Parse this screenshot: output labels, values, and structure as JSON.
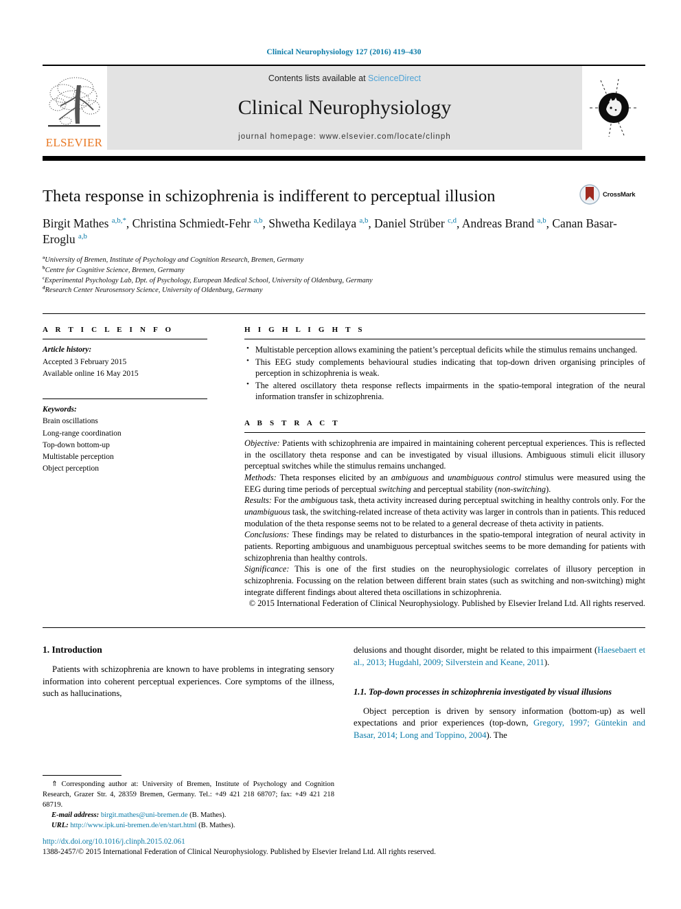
{
  "running_head": "Clinical Neurophysiology 127 (2016) 419–430",
  "masthead": {
    "contents_prefix": "Contents lists available at ",
    "sciencedirect": "ScienceDirect",
    "journal_title": "Clinical Neurophysiology",
    "homepage": "journal homepage: www.elsevier.com/locate/clinph",
    "publisher_wordmark": "ELSEVIER",
    "publisher_logo_name": "elsevier-tree-logo",
    "journal_cover_name": "journal-cover-thumbnail"
  },
  "colors": {
    "link": "#0b7ba8",
    "sciencedirect": "#4ea3d6",
    "elsevier_orange": "#E87722",
    "masthead_bg": "#e3e3e3",
    "crossmark_red": "#9e2a20"
  },
  "article": {
    "title": "Theta response in schizophrenia is indifferent to perceptual illusion",
    "crossmark_label": "CrossMark",
    "authors_html": "Birgit Mathes <sup>a,b,*</sup>, Christina Schmiedt-Fehr <sup>a,b</sup>, Shwetha Kedilaya <sup>a,b</sup>, Daniel Strüber <sup>c,d</sup>, Andreas Brand <sup>a,b</sup>, Canan Basar-Eroglu <sup>a,b</sup>",
    "affiliations": [
      {
        "marker": "a",
        "text": "University of Bremen, Institute of Psychology and Cognition Research, Bremen, Germany"
      },
      {
        "marker": "b",
        "text": "Centre for Cognitive Science, Bremen, Germany"
      },
      {
        "marker": "c",
        "text": "Experimental Psychology Lab, Dpt. of Psychology, European Medical School, University of Oldenburg, Germany"
      },
      {
        "marker": "d",
        "text": "Research Center Neurosensory Science, University of Oldenburg, Germany"
      }
    ]
  },
  "article_info": {
    "heading": "A R T I C L E   I N F O",
    "history_label": "Article history:",
    "history": [
      "Accepted 3 February 2015",
      "Available online 16 May 2015"
    ],
    "keywords_label": "Keywords:",
    "keywords": [
      "Brain oscillations",
      "Long-range coordination",
      "Top-down bottom-up",
      "Multistable perception",
      "Object perception"
    ]
  },
  "highlights": {
    "heading": "H I G H L I G H T S",
    "items": [
      "Multistable perception allows examining the patient’s perceptual deficits while the stimulus remains unchanged.",
      "This EEG study complements behavioural studies indicating that top-down driven organising principles of perception in schizophrenia is weak.",
      "The altered oscillatory theta response reflects impairments in the spatio-temporal integration of the neural information transfer in schizophrenia."
    ]
  },
  "abstract": {
    "heading": "A B S T R A C T",
    "sections": [
      {
        "label": "Objective:",
        "text_html": "Patients with schizophrenia are impaired in maintaining coherent perceptual experiences. This is reflected in the oscillatory theta response and can be investigated by visual illusions. Ambiguous stimuli elicit illusory perceptual switches while the stimulus remains unchanged."
      },
      {
        "label": "Methods:",
        "text_html": "Theta responses elicited by an <i>ambiguous</i> and <i>unambiguous control</i> stimulus were measured using the EEG during time periods of perceptual <i>switching</i> and perceptual stability (<i>non-switching</i>)."
      },
      {
        "label": "Results:",
        "text_html": "For the <i>ambiguous</i> task, theta activity increased during perceptual switching in healthy controls only. For the <i>unambiguous</i> task, the switching-related increase of theta activity was larger in controls than in patients. This reduced modulation of the theta response seems not to be related to a general decrease of theta activity in patients."
      },
      {
        "label": "Conclusions:",
        "text_html": "These findings may be related to disturbances in the spatio-temporal integration of neural activity in patients. Reporting ambiguous and unambiguous perceptual switches seems to be more demanding for patients with schizophrenia than healthy controls."
      },
      {
        "label": "Significance:",
        "text_html": "This is one of the first studies on the neurophysiologic correlates of illusory perception in schizophrenia. Focussing on the relation between different brain states (such as switching and non-switching) might integrate different findings about altered theta oscillations in schizophrenia."
      }
    ],
    "copyright": "© 2015 International Federation of Clinical Neurophysiology. Published by Elsevier Ireland Ltd. All rights reserved."
  },
  "body": {
    "left": {
      "section_number_title": "1. Introduction",
      "paragraph_html": "Patients with schizophrenia are known to have problems in integrating sensory information into coherent perceptual experiences. Core symptoms of the illness, such as hallucinations,"
    },
    "right": {
      "continuation_html": "delusions and thought disorder, might be related to this impairment (<span class=\"ref\">Haesebaert et al., 2013; Hugdahl, 2009; Silverstein and Keane, 2011</span>).",
      "subsection_title": "1.1. Top-down processes in schizophrenia investigated by visual illusions",
      "paragraph_html": "Object perception is driven by sensory information (bottom-up) as well expectations and prior experiences (top-down, <span class=\"ref\">Gregory, 1997; Güntekin and Basar, 2014; Long and Toppino, 2004</span>). The"
    }
  },
  "footnote": {
    "corresponding_html": "<span class=\"star\">⇑</span> Corresponding author at: University of Bremen, Institute of Psychology and Cognition Research, Grazer Str. 4, 28359 Bremen, Germany. Tel.: +49 421 218 68707; fax: +49 421 218 68719.",
    "email_label": "E-mail address:",
    "email": "birgit.mathes@uni-bremen.de",
    "email_suffix": "(B. Mathes).",
    "url_label": "URL:",
    "url": "http://www.ipk.uni-bremen.de/en/start.html",
    "url_suffix": "(B. Mathes)."
  },
  "footer": {
    "doi": "http://dx.doi.org/10.1016/j.clinph.2015.02.061",
    "issn_line": "1388-2457/© 2015 International Federation of Clinical Neurophysiology. Published by Elsevier Ireland Ltd. All rights reserved."
  }
}
